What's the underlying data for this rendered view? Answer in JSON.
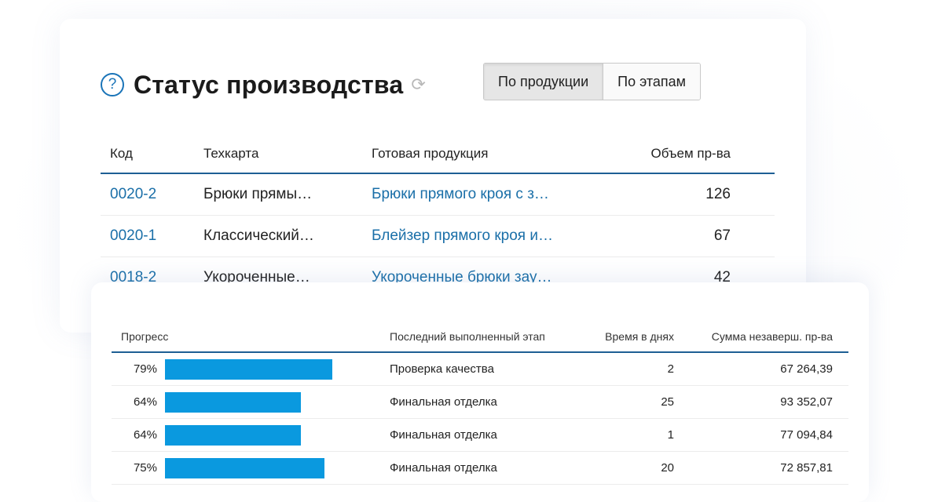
{
  "header": {
    "title": "Статус производства",
    "help_icon": "?",
    "refresh_icon": "⟳",
    "tabs": [
      {
        "label": "По продукции",
        "active": true
      },
      {
        "label": "По этапам",
        "active": false
      }
    ]
  },
  "products_table": {
    "columns": [
      "Код",
      "Техкарта",
      "Готовая продукция",
      "Объем пр-ва"
    ],
    "rows": [
      {
        "code": "0020-2",
        "techcard": "Брюки прямы…",
        "product": "Брюки прямого кроя с з…",
        "volume": "126"
      },
      {
        "code": "0020-1",
        "techcard": "Классический…",
        "product": "Блейзер прямого кроя и…",
        "volume": "67"
      },
      {
        "code": "0018-2",
        "techcard": "Укороченные…",
        "product": "Укороченные брюки зау…",
        "volume": "42"
      }
    ]
  },
  "progress_table": {
    "columns": [
      "Прогресс",
      "Последний выполненный этап",
      "Время в днях",
      "Сумма незаверш. пр-ва"
    ],
    "rows": [
      {
        "percent": "79%",
        "progress": 0.79,
        "stage": "Проверка качества",
        "days": "2",
        "sum": "67 264,39"
      },
      {
        "percent": "64%",
        "progress": 0.64,
        "stage": "Финальная отделка",
        "days": "25",
        "sum": "93 352,07"
      },
      {
        "percent": "64%",
        "progress": 0.64,
        "stage": "Финальная отделка",
        "days": "1",
        "sum": "77 094,84"
      },
      {
        "percent": "75%",
        "progress": 0.75,
        "stage": "Финальная отделка",
        "days": "20",
        "sum": "72 857,81"
      }
    ]
  },
  "colors": {
    "accent": "#1a6fa8",
    "bar": "#0a99df",
    "rule": "#1e5f94"
  }
}
